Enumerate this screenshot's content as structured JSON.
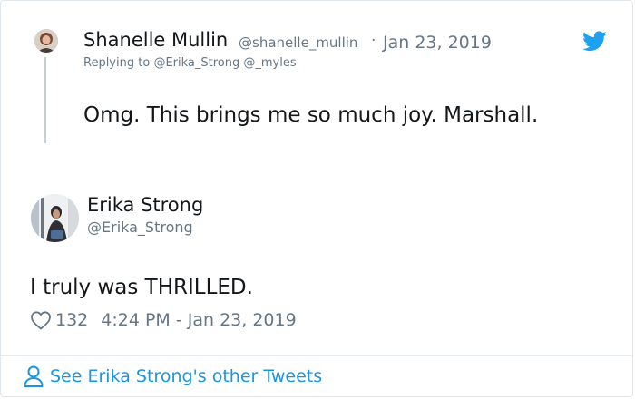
{
  "parent_tweet": {
    "author_name": "Shanelle Mullin",
    "author_handle": "@shanelle_mullin",
    "separator": "·",
    "date": "Jan 23, 2019",
    "replying_prefix": "Replying to",
    "replying_to": [
      "@Erika_Strong",
      "@_myles"
    ],
    "text": "Omg. This brings me so much joy. Marshall.",
    "avatar_icon": "profile-photo"
  },
  "main_tweet": {
    "author_name": "Erika Strong",
    "author_handle": "@Erika_Strong",
    "text": "I truly was THRILLED.",
    "like_count": "132",
    "timestamp": "4:24 PM - Jan 23, 2019",
    "avatar_icon": "profile-photo"
  },
  "footer": {
    "link_text": "See Erika Strong's other Tweets",
    "icon": "person-icon"
  },
  "colors": {
    "text_primary": "#14171a",
    "text_secondary": "#657786",
    "link_blue": "#1b95e0",
    "twitter_blue": "#1da1f2",
    "thread_line": "#c4cfd6",
    "border": "#e1e8ed"
  },
  "icons": {
    "brand": "twitter-bird-icon",
    "like": "heart-icon"
  }
}
